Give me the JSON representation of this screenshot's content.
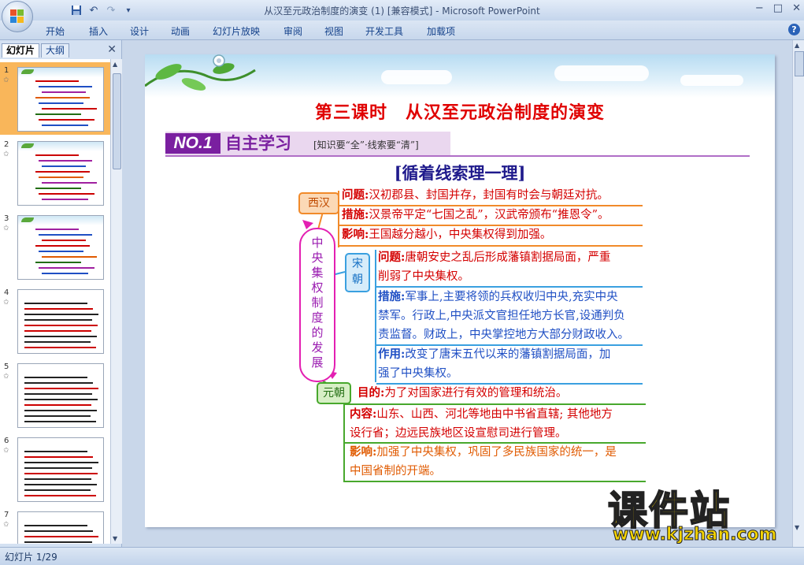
{
  "window": {
    "title": "从汉至元政治制度的演变 (1) [兼容模式] - Microsoft PowerPoint",
    "minimize": "−",
    "maximize": "□",
    "close": "✕"
  },
  "qat": {
    "save_icon": "floppy-disk-icon",
    "undo": "↶",
    "redo": "↷",
    "customize": "▾"
  },
  "ribbon": {
    "tabs": [
      "开始",
      "插入",
      "设计",
      "动画",
      "幻灯片放映",
      "审阅",
      "视图",
      "开发工具",
      "加载项"
    ],
    "help": "?"
  },
  "left_pane": {
    "tabs": [
      "幻灯片",
      "大纲"
    ],
    "close": "✕",
    "thumbnails": [
      {
        "number": "1",
        "star": "✩",
        "selected": true
      },
      {
        "number": "2",
        "star": "✩",
        "selected": false
      },
      {
        "number": "3",
        "star": "✩",
        "selected": false
      },
      {
        "number": "4",
        "star": "✩",
        "selected": false
      },
      {
        "number": "5",
        "star": "✩",
        "selected": false
      },
      {
        "number": "6",
        "star": "✩",
        "selected": false
      },
      {
        "number": "7",
        "star": "✩",
        "selected": false
      }
    ]
  },
  "slide": {
    "title": "第三课时　从汉至元政治制度的演变",
    "badge": "NO.1",
    "section": "自主学习",
    "section_sub": "[知识要“全”·线索要“清”]",
    "heading": "[循着线索理一理]",
    "center_label": "中央集权制度的发展",
    "xihan": {
      "node": "西汉",
      "rows": [
        {
          "key": "问题:",
          "text": "汉初郡县、封国并存，封国有时会与朝廷对抗。"
        },
        {
          "key": "措施:",
          "text": "汉景帝平定“七国之乱”，汉武帝颁布“推恩令”。"
        },
        {
          "key": "影响:",
          "text": "王国越分越小，中央集权得到加强。"
        }
      ]
    },
    "song": {
      "node": "宋朝",
      "rows": [
        {
          "key": "问题:",
          "lines": [
            "唐朝安史之乱后形成藩镇割据局面，严重",
            "削弱了中央集权。"
          ]
        },
        {
          "key": "措施:",
          "lines": [
            "军事上,主要将领的兵权收归中央,充实中央",
            "禁军。行政上,中央派文官担任地方长官,设通判负",
            "责监督。财政上，中央掌控地方大部分财政收入。"
          ]
        },
        {
          "key": "作用:",
          "lines": [
            "改变了唐末五代以来的藩镇割据局面，加",
            "强了中央集权。"
          ]
        }
      ]
    },
    "yuan": {
      "node": "元朝",
      "rows": [
        {
          "key": "目的:",
          "lines": [
            "为了对国家进行有效的管理和统治。"
          ]
        },
        {
          "key": "内容:",
          "lines": [
            "山东、山西、河北等地由中书省直辖; 其他地方",
            "设行省；边远民族地区设宣慰司进行管理。"
          ]
        },
        {
          "key": "影响:",
          "lines": [
            "加强了中央集权，巩固了多民族国家的统一，是",
            "中国省制的开端。"
          ]
        }
      ]
    }
  },
  "status": {
    "slide_indicator": "幻灯片 1/29"
  },
  "watermark": {
    "main": "课件站",
    "url": "www.kjzhan.com"
  },
  "colors": {
    "title_red": "#e00000",
    "badge_purple": "#7a1fa0",
    "heading_navy": "#1f1a8c",
    "xihan_orange": "#f18a2a",
    "song_blue": "#3aa0e0",
    "yuan_green": "#48a82d",
    "selected_thumb": "#f9b65a"
  }
}
